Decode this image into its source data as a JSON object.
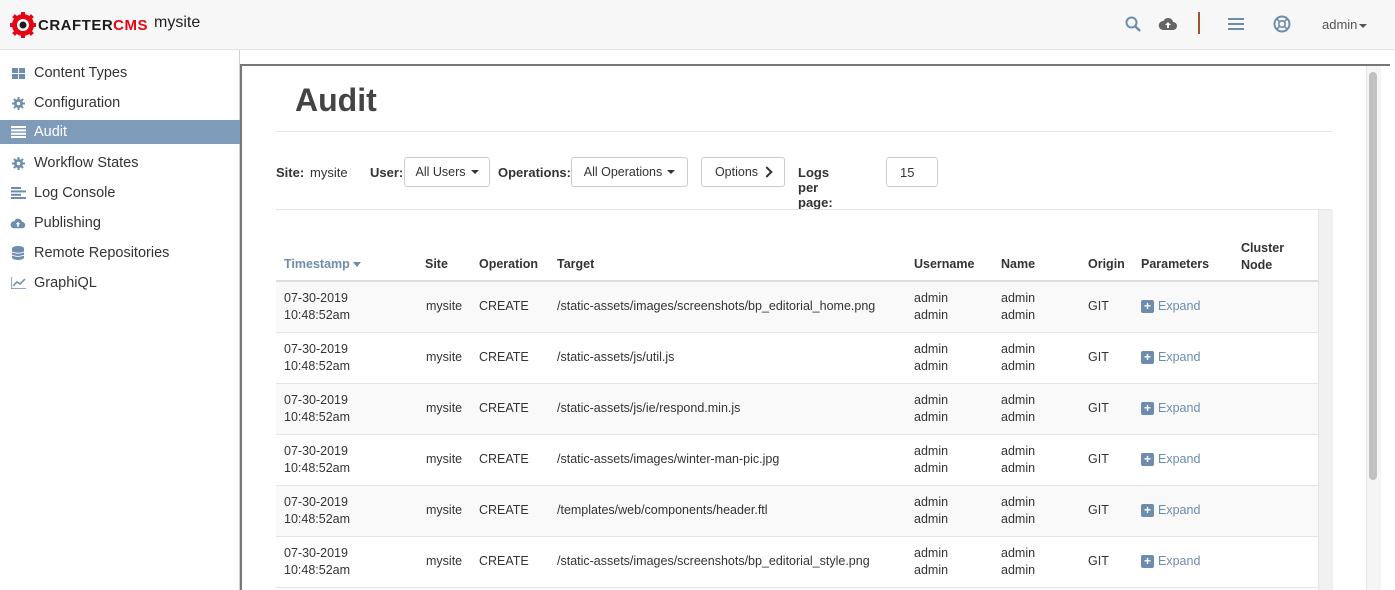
{
  "header": {
    "logo_text_a": "CRAFTER",
    "logo_text_b": "CMS",
    "site_name": "mysite",
    "user_label": "admin",
    "icons": [
      "search-icon",
      "cloud-upload-icon",
      "menu-icon",
      "help-icon"
    ]
  },
  "sidebar": {
    "items": [
      {
        "label": "Content Types",
        "icon": "grid-icon"
      },
      {
        "label": "Configuration",
        "icon": "gear-icon"
      },
      {
        "label": "Audit",
        "icon": "list-icon",
        "active": true
      },
      {
        "label": "Workflow States",
        "icon": "gear-icon"
      },
      {
        "label": "Log Console",
        "icon": "align-left-icon"
      },
      {
        "label": "Publishing",
        "icon": "cloud-upload-icon"
      },
      {
        "label": "Remote Repositories",
        "icon": "database-icon"
      },
      {
        "label": "GraphiQL",
        "icon": "line-chart-icon"
      }
    ]
  },
  "page": {
    "title": "Audit"
  },
  "filters": {
    "site_label": "Site:",
    "site_value": "mysite",
    "user_label": "User:",
    "user_select": "All Users",
    "operations_label": "Operations:",
    "operations_select": "All Operations",
    "options_button": "Options",
    "logs_label": "Logs per page:",
    "logs_value": "15"
  },
  "table": {
    "columns": {
      "timestamp": "Timestamp",
      "site": "Site",
      "operation": "Operation",
      "target": "Target",
      "username": "Username",
      "name": "Name",
      "origin": "Origin",
      "parameters": "Parameters",
      "cluster_a": "Cluster",
      "cluster_b": "Node"
    },
    "expand_label": "Expand",
    "rows": [
      {
        "date": "07-30-2019",
        "time": "10:48:52am",
        "site": "mysite",
        "operation": "CREATE",
        "target": "/static-assets/images/screenshots/bp_editorial_home.png",
        "username": "admin",
        "username2": "admin",
        "name": "admin",
        "name2": "admin",
        "origin": "GIT"
      },
      {
        "date": "07-30-2019",
        "time": "10:48:52am",
        "site": "mysite",
        "operation": "CREATE",
        "target": "/static-assets/js/util.js",
        "username": "admin",
        "username2": "admin",
        "name": "admin",
        "name2": "admin",
        "origin": "GIT"
      },
      {
        "date": "07-30-2019",
        "time": "10:48:52am",
        "site": "mysite",
        "operation": "CREATE",
        "target": "/static-assets/js/ie/respond.min.js",
        "username": "admin",
        "username2": "admin",
        "name": "admin",
        "name2": "admin",
        "origin": "GIT"
      },
      {
        "date": "07-30-2019",
        "time": "10:48:52am",
        "site": "mysite",
        "operation": "CREATE",
        "target": "/static-assets/images/winter-man-pic.jpg",
        "username": "admin",
        "username2": "admin",
        "name": "admin",
        "name2": "admin",
        "origin": "GIT"
      },
      {
        "date": "07-30-2019",
        "time": "10:48:52am",
        "site": "mysite",
        "operation": "CREATE",
        "target": "/templates/web/components/header.ftl",
        "username": "admin",
        "username2": "admin",
        "name": "admin",
        "name2": "admin",
        "origin": "GIT"
      },
      {
        "date": "07-30-2019",
        "time": "10:48:52am",
        "site": "mysite",
        "operation": "CREATE",
        "target": "/static-assets/images/screenshots/bp_editorial_style.png",
        "username": "admin",
        "username2": "admin",
        "name": "admin",
        "name2": "admin",
        "origin": "GIT"
      }
    ]
  },
  "colors": {
    "accent": "#6d8cae",
    "active_nav": "#7e9bba",
    "brand_red": "#e30613"
  }
}
